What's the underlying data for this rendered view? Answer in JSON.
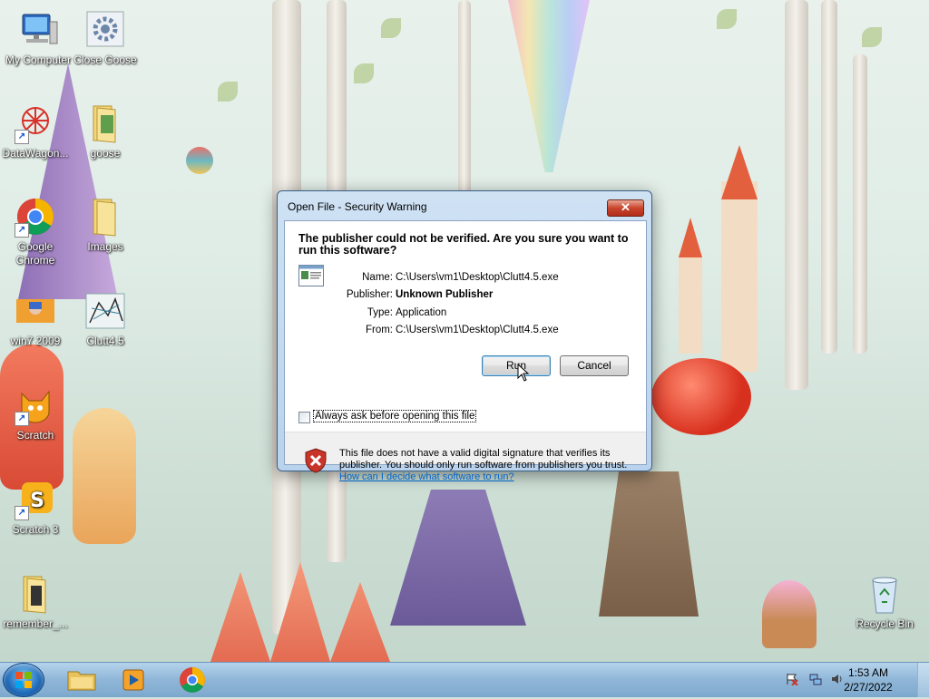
{
  "desktop": {
    "icons": [
      {
        "label": "My Computer"
      },
      {
        "label": "Close Goose"
      },
      {
        "label": "DataWagon..."
      },
      {
        "label": "goose"
      },
      {
        "label": "Google Chrome"
      },
      {
        "label": "Images"
      },
      {
        "label": "win7 2009"
      },
      {
        "label": "Clutt4.5"
      },
      {
        "label": "Scratch"
      },
      {
        "label": "Scratch 3"
      },
      {
        "label": "remember_..."
      },
      {
        "label": "Recycle Bin"
      }
    ]
  },
  "dialog": {
    "title": "Open File - Security Warning",
    "close_glyph": "✕",
    "headline": "The publisher could not be verified.  Are you sure you want to run this software?",
    "fields": [
      {
        "label": "Name:",
        "value": "C:\\Users\\vm1\\Desktop\\Clutt4.5.exe"
      },
      {
        "label": "Publisher:",
        "value": "Unknown Publisher"
      },
      {
        "label": "Type:",
        "value": "Application"
      },
      {
        "label": "From:",
        "value": "C:\\Users\\vm1\\Desktop\\Clutt4.5.exe"
      }
    ],
    "run_label": "Run",
    "cancel_label": "Cancel",
    "checkbox_label": "Always ask before opening this file",
    "checkbox_checked": false,
    "warning_text": "This file does not have a valid digital signature that verifies its publisher.  You should only run software from publishers you trust.",
    "help_link": "How can I decide what software to run?"
  },
  "taskbar": {
    "pinned": [
      "windows-explorer",
      "media-player",
      "google-chrome"
    ],
    "clock_time": "1:53 AM",
    "clock_date": "2/27/2022"
  },
  "colors": {
    "link": "#0066cc",
    "close_button": "#c9442c",
    "dialog_frame": "#b9d3ee"
  }
}
